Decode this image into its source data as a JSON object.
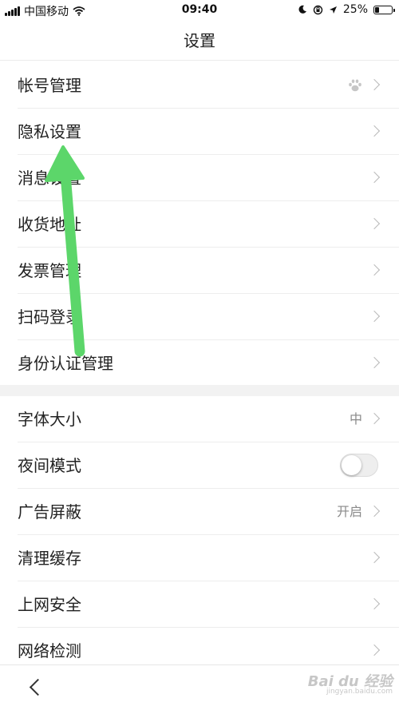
{
  "status_bar": {
    "carrier": "中国移动",
    "time": "09:40",
    "battery": "25%",
    "battery_level": 0.25
  },
  "nav": {
    "title": "设置"
  },
  "group1": [
    {
      "label": "帐号管理",
      "icon": "baidu-paw-icon"
    },
    {
      "label": "隐私设置"
    },
    {
      "label": "消息设置"
    },
    {
      "label": "收货地址"
    },
    {
      "label": "发票管理"
    },
    {
      "label": "扫码登录"
    },
    {
      "label": "身份认证管理"
    }
  ],
  "group2": [
    {
      "label": "字体大小",
      "value": "中"
    },
    {
      "label": "夜间模式",
      "toggle": false
    },
    {
      "label": "广告屏蔽",
      "value": "开启"
    },
    {
      "label": "清理缓存"
    },
    {
      "label": "上网安全"
    },
    {
      "label": "网络检测"
    }
  ],
  "watermark": {
    "main": "Bai du 经验",
    "sub": "jingyan.baidu.com"
  },
  "colors": {
    "annotation_arrow": "#5cd66a",
    "toggle_off": "#eeeeee"
  }
}
